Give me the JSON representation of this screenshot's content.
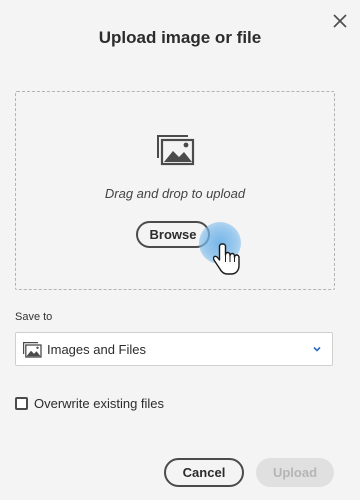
{
  "dialog": {
    "title": "Upload image or file",
    "close_icon": "close-icon"
  },
  "dropzone": {
    "icon": "images-icon",
    "instruction": "Drag and drop to upload",
    "browse_label": "Browse"
  },
  "save_to": {
    "label": "Save to",
    "selected": "Images and Files",
    "icon": "images-icon"
  },
  "overwrite": {
    "label": "Overwrite existing files",
    "checked": false
  },
  "footer": {
    "cancel_label": "Cancel",
    "upload_label": "Upload",
    "upload_enabled": false
  },
  "colors": {
    "background": "#f4f4f4",
    "hover_accent": "#5aa8e6",
    "disabled_text": "#b5b5b5"
  }
}
